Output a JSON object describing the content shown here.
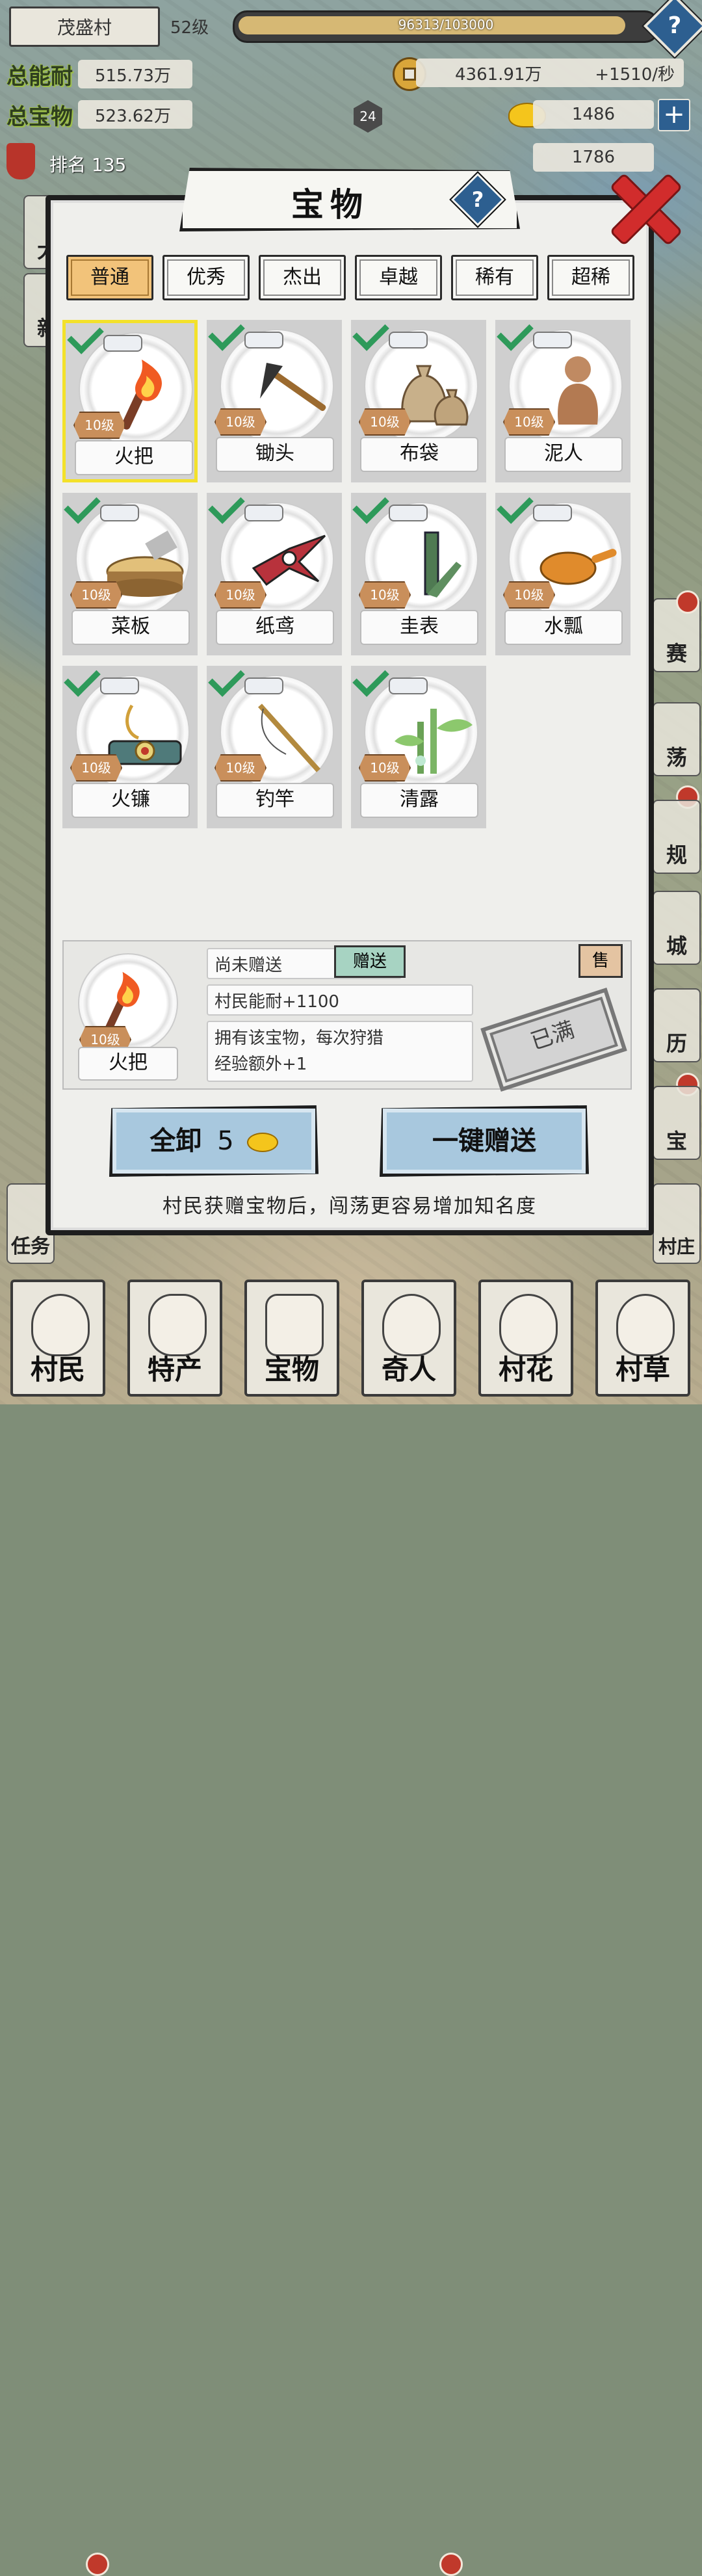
{
  "hud": {
    "village_name": "茂盛村",
    "village_level": "52级",
    "xp_text": "96313/103000",
    "xp_progress": 0.935,
    "total_ability_label": "总能耐",
    "total_ability_value": "515.73万",
    "total_wealth_label": "总宝物",
    "total_wealth_value": "523.62万",
    "rank_text": "排名 135",
    "copper_value": "4361.91万",
    "copper_rate": "+1510/秒",
    "gold_value": "1486",
    "third_value": "1786",
    "hex_level": "24",
    "help": "?",
    "plus": "+"
  },
  "side_buttons": [
    "大",
    "新",
    "赛",
    "荡",
    "规",
    "城",
    "历",
    "宝",
    "村庄"
  ],
  "task_button": "任务",
  "modal": {
    "title": "宝物",
    "help": "?",
    "tabs": [
      {
        "label": "普通",
        "active": true
      },
      {
        "label": "优秀",
        "active": false
      },
      {
        "label": "杰出",
        "active": false
      },
      {
        "label": "卓越",
        "active": false
      },
      {
        "label": "稀有",
        "active": false
      },
      {
        "label": "超稀",
        "active": false
      }
    ],
    "items": [
      {
        "name": "火把",
        "level": "10级",
        "icon": "torch-icon",
        "selected": true
      },
      {
        "name": "锄头",
        "level": "10级",
        "icon": "hoe-icon"
      },
      {
        "name": "布袋",
        "level": "10级",
        "icon": "cloth-bag-icon"
      },
      {
        "name": "泥人",
        "level": "10级",
        "icon": "clay-figure-icon"
      },
      {
        "name": "菜板",
        "level": "10级",
        "icon": "chopping-board-icon"
      },
      {
        "name": "纸鸢",
        "level": "10级",
        "icon": "kite-icon"
      },
      {
        "name": "圭表",
        "level": "10级",
        "icon": "sundial-icon"
      },
      {
        "name": "水瓢",
        "level": "10级",
        "icon": "ladle-icon"
      },
      {
        "name": "火镰",
        "level": "10级",
        "icon": "fire-striker-icon"
      },
      {
        "name": "钓竿",
        "level": "10级",
        "icon": "fishing-rod-icon"
      },
      {
        "name": "清露",
        "level": "10级",
        "icon": "bamboo-dew-icon"
      }
    ],
    "detail": {
      "name": "火把",
      "level": "10级",
      "status": "尚未赠送",
      "give_label": "赠送",
      "sell_label": "售",
      "bonus": "村民能耐+1100",
      "desc_line1": "拥有该宝物，每次狩猎",
      "desc_line2": "经验额外+1",
      "stamp": "已满"
    },
    "unload_label": "全卸",
    "unload_cost": "5",
    "give_all_label": "一键赠送",
    "tip": "村民获赠宝物后，闯荡更容易增加知名度"
  },
  "bottom_nav": [
    "村民",
    "特产",
    "宝物",
    "奇人",
    "村花",
    "村草"
  ],
  "colors": {
    "accent_tab": "#f2c37a",
    "button_blue": "#a8c8de",
    "check_green": "#2e9a5a",
    "close_red": "#d12c2c",
    "selection": "#f3e12a"
  }
}
